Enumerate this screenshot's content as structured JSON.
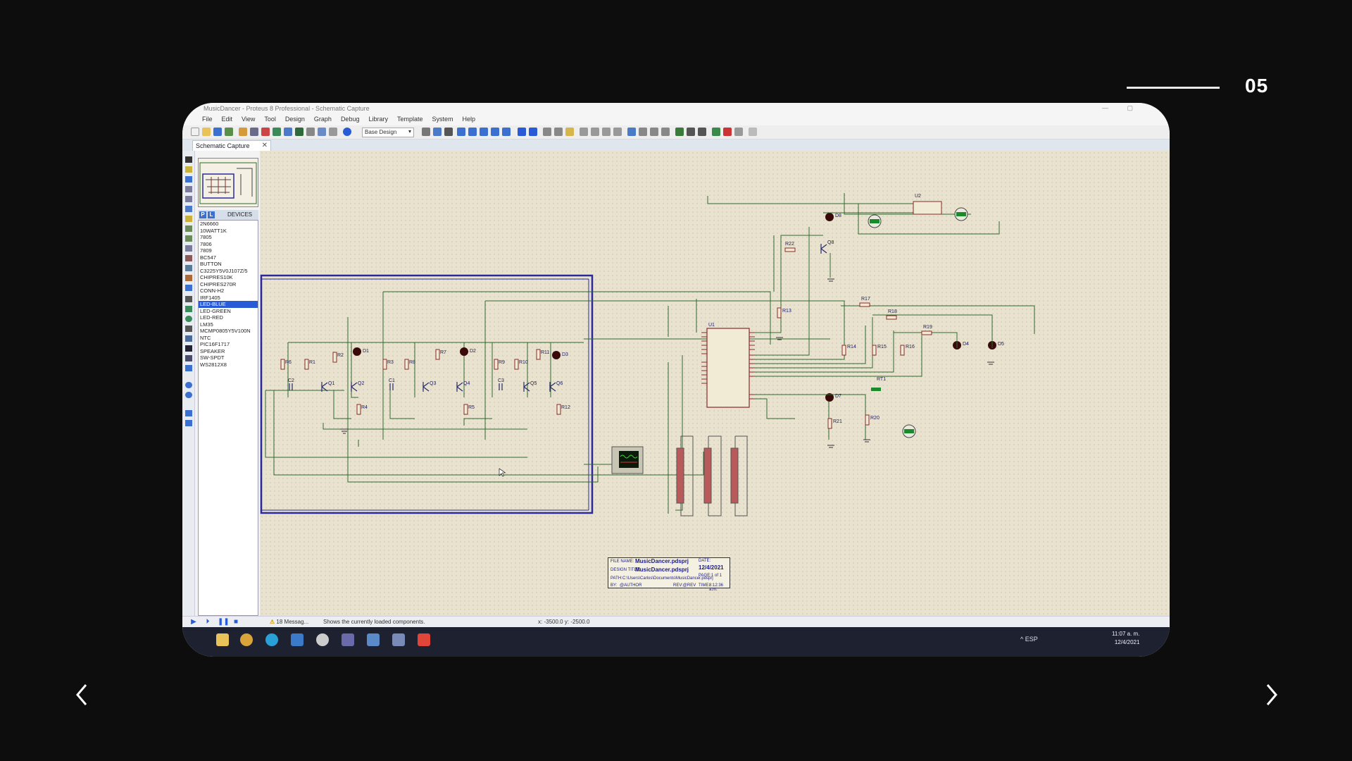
{
  "slide": {
    "counter": "05"
  },
  "app": {
    "window_title": "MusicDancer - Proteus 8 Professional - Schematic Capture",
    "window_controls": "—  ▢",
    "menu": [
      "File",
      "Edit",
      "View",
      "Tool",
      "Design",
      "Graph",
      "Debug",
      "Library",
      "Template",
      "System",
      "Help"
    ],
    "toolbar": {
      "design_select": "Base Design"
    },
    "tab": {
      "label": "Schematic Capture",
      "close": "✕"
    },
    "devices": {
      "p_label": "P",
      "l_label": "L",
      "title": "DEVICES",
      "items": [
        "2N6660",
        "10WATT1K",
        "7805",
        "7806",
        "7809",
        "BC547",
        "BUTTON",
        "C3225Y5V0J107Z/5",
        "CHIPRES10K",
        "CHIPRES270R",
        "CONN-H2",
        "IRF1405",
        "LED-BLUE",
        "LED-GREEN",
        "LED-RED",
        "LM35",
        "MCMP0805Y5V100N",
        "NTC",
        "PIC16F1717",
        "SPEAKER",
        "SW-SPDT",
        "WS2812X8"
      ],
      "selected": "LED-BLUE"
    },
    "schematic": {
      "labels": {
        "R6": "R6",
        "R1": "R1",
        "R2": "R2",
        "D1": "D1",
        "R3": "R3",
        "R8": "R8",
        "R7": "R7",
        "D2": "D2",
        "R9": "R9",
        "R10": "R10",
        "R11": "R11",
        "D3": "D3",
        "C2": "C2",
        "Q1": "Q1",
        "Q2": "Q2",
        "C1": "C1",
        "Q3": "Q3",
        "Q4": "Q4",
        "C3": "C3",
        "Q5": "Q5",
        "Q6": "Q6",
        "R4": "R4",
        "R5": "R5",
        "R12": "R12",
        "U1": "U1",
        "U2": "U2",
        "Q8": "Q8",
        "D8": "D8",
        "R22": "R22",
        "R13": "R13",
        "R14": "R14",
        "R15": "R15",
        "R16": "R16",
        "R17": "R17",
        "R18": "R18",
        "R19": "R19",
        "D4": "D4",
        "D7": "D7",
        "R21": "R21",
        "RT1": "RT1",
        "R20": "R20",
        "D5": "D5"
      },
      "title_block": {
        "file_name_label": "FILE NAME:",
        "file_name": "MusicDancer.pdsprj",
        "design_title_label": "DESIGN TITLE:",
        "design_title": "MusicDancer.pdsprj",
        "path_label": "PATH:",
        "path": "C:\\Users\\Carlos\\Documents\\MusicDancer.pdsprj",
        "by_label": "BY:",
        "by": "@AUTHOR",
        "rev": "REV:@REV",
        "date_label": "DATE:",
        "date": "12/4/2021",
        "page_label": "PAGE:",
        "page": "1 of 1",
        "time_label": "TIME:",
        "time": "8:12:36 a.m."
      }
    },
    "status": {
      "messages": "18 Messag...",
      "hint": "Shows the currently loaded components.",
      "x_label": "x:",
      "x": "-3500.0",
      "y_label": "y:",
      "y": "-2500.0"
    },
    "taskbar": {
      "tray": "^  ESP",
      "time": "11:07 a. m.",
      "date": "12/4/2021"
    }
  },
  "colors": {
    "canvas": "#e8e2cf",
    "wire": "#2f6b2f",
    "sheet_border": "#2a2a9a",
    "component": "#8a2a2a",
    "selected": "#2a5bd7"
  }
}
